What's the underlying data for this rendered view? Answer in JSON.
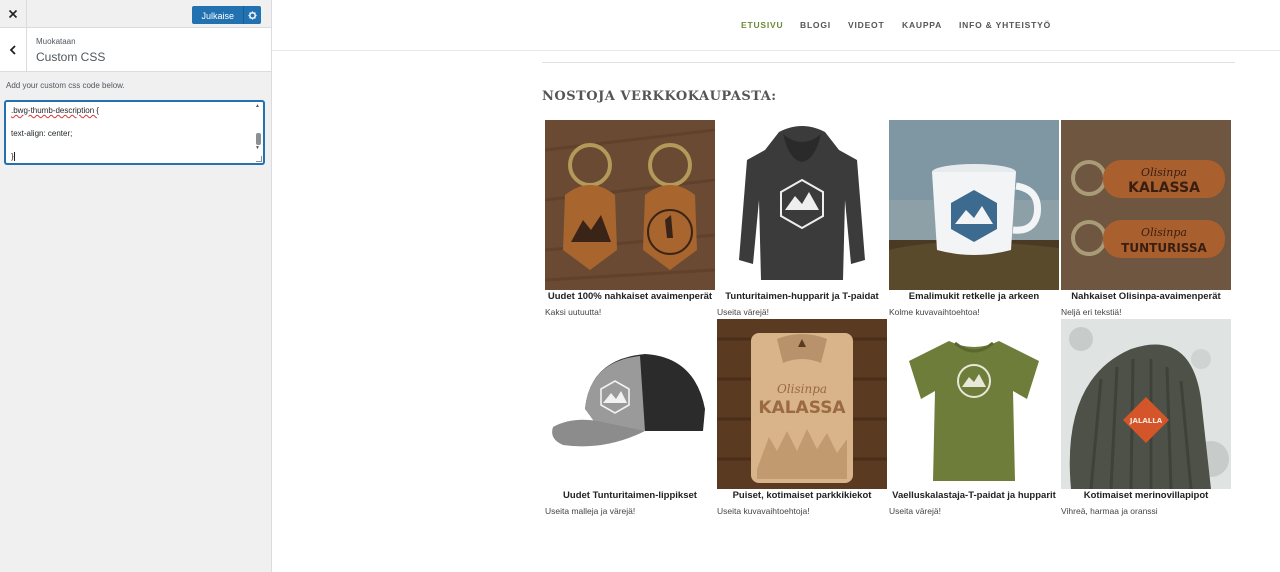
{
  "customizer": {
    "publish_label": "Julkaise",
    "section_subtitle": "Muokataan",
    "section_title": "Custom CSS",
    "description": "Add your custom css code below.",
    "css_lines": [
      ".bwg-thumb-description {",
      "",
      "text-align: center;",
      "",
      "}"
    ]
  },
  "site": {
    "nav": [
      "ETUSIVU",
      "BLOGI",
      "VIDEOT",
      "KAUPPA",
      "INFO & YHTEISTYÖ"
    ],
    "active_nav": "ETUSIVU",
    "section_heading": "NOSTOJA VERKKOKAUPASTA:",
    "products": [
      {
        "title": "Uudet 100% nahkaiset avaimenperät",
        "desc": "Kaksi uutuutta!",
        "image": "leather-keychains"
      },
      {
        "title": "Tunturitaimen-hupparit ja T-paidat",
        "desc": "Useita värejä!",
        "image": "hoodie"
      },
      {
        "title": "Emalimukit retkelle ja arkeen",
        "desc": "Kolme kuvavaihtoehtoa!",
        "image": "enamel-mug"
      },
      {
        "title": "Nahkaiset Olisinpa-avaimenperät",
        "desc": "Neljä eri tekstiä!",
        "image": "olisinpa-keychains"
      },
      {
        "title": "Uudet Tunturitaimen-lippikset",
        "desc": "Useita malleja ja värejä!",
        "image": "cap"
      },
      {
        "title": "Puiset, kotimaiset parkkikiekot",
        "desc": "Useita kuvavaihtoehtoja!",
        "image": "parking-disc"
      },
      {
        "title": "Vaelluskalastaja-T-paidat ja hupparit",
        "desc": "Useita värejä!",
        "image": "tshirt"
      },
      {
        "title": "Kotimaiset merinovillapipot",
        "desc": "Vihreä, harmaa ja oranssi",
        "image": "beanie"
      }
    ],
    "image_text": {
      "olisinpa_1": "Olisinpa",
      "kalassa_1": "KALASSA",
      "olisinpa_2": "Olisinpa",
      "tunturissa": "TUNTURISSA",
      "olisinpa_3": "Olisinpa",
      "kalassa_3": "KALASSA",
      "beanie_patch": "JALALLA"
    }
  },
  "colors": {
    "accent": "#2271b1",
    "nav_active": "#6e8a3a"
  }
}
